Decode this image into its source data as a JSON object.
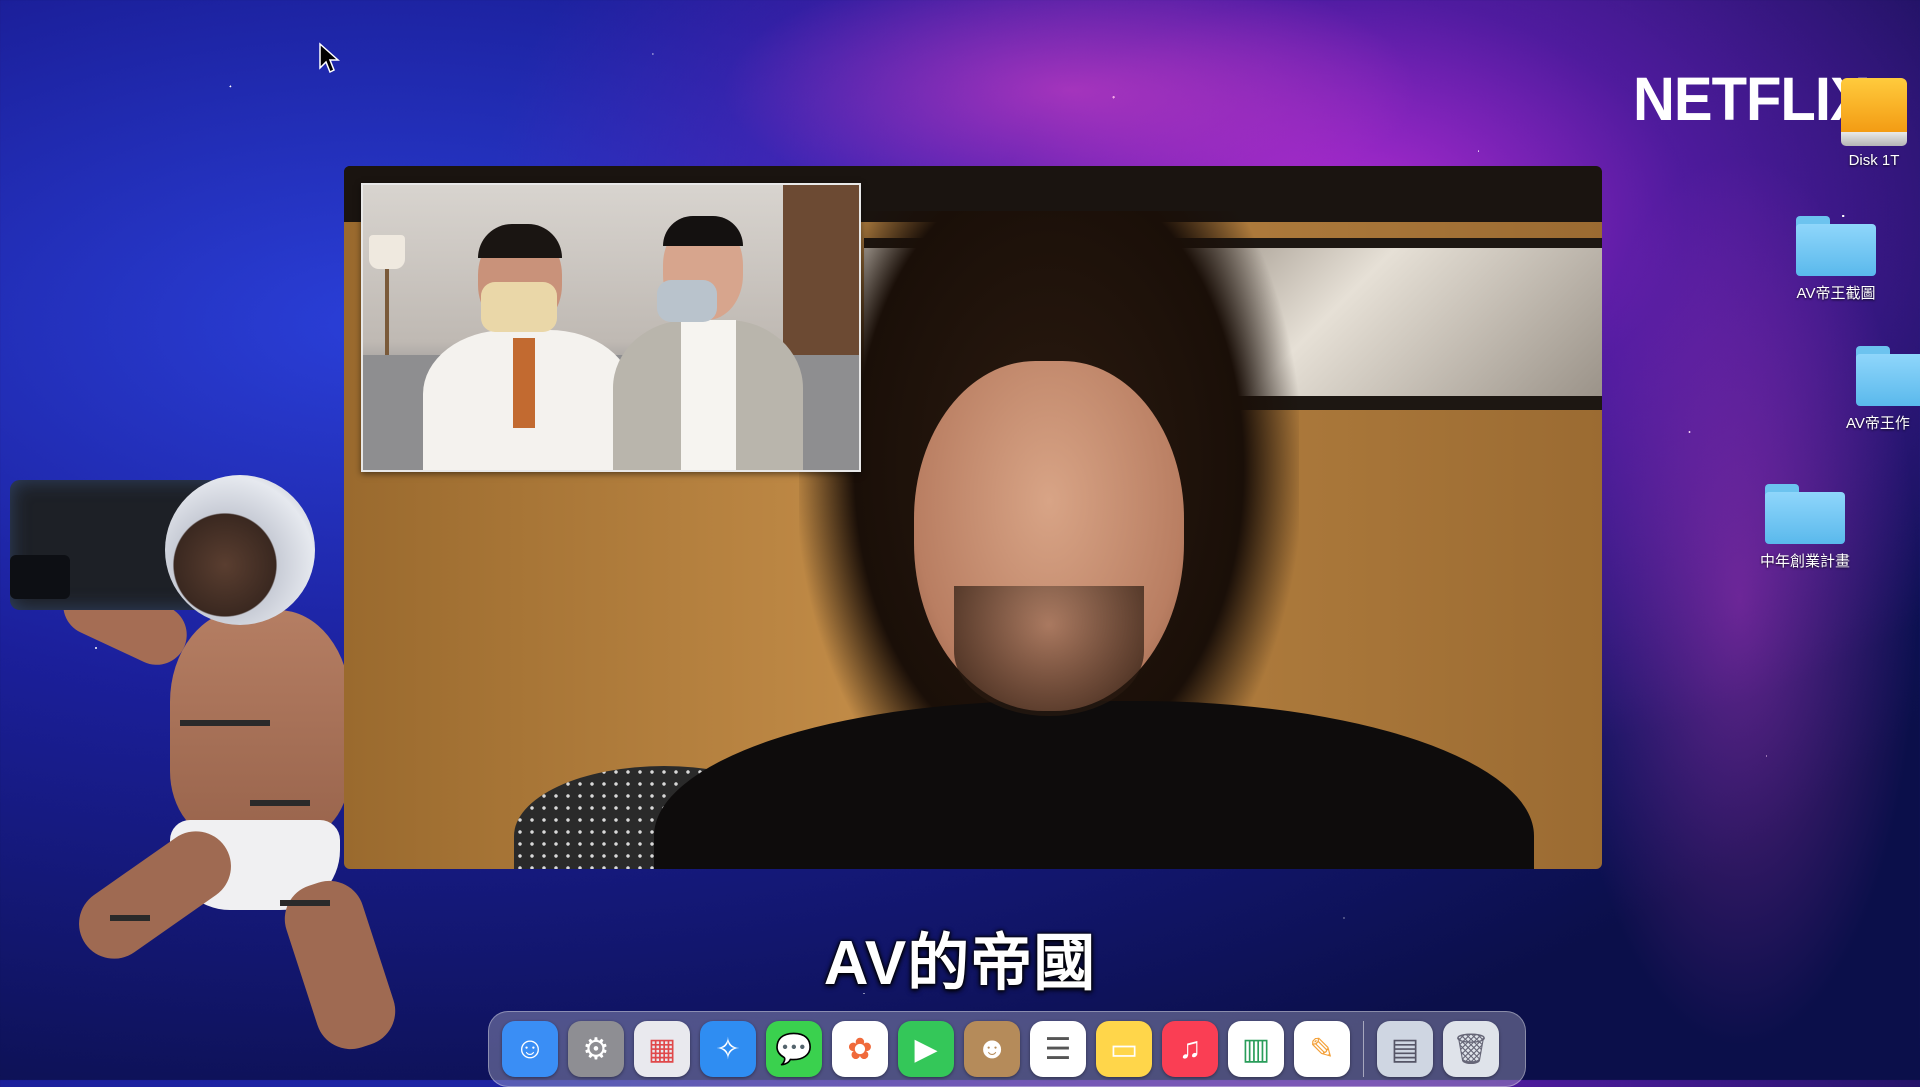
{
  "brand": {
    "logo_text": "NETFLIX"
  },
  "subtitle": {
    "text": "AV的帝國"
  },
  "desktop_icons": [
    {
      "label": "Disk 1T",
      "type": "drive"
    },
    {
      "label": "AV帝王截圖",
      "type": "folder"
    },
    {
      "label": "AV帝王作",
      "type": "folder"
    },
    {
      "label": "中年創業計畫",
      "type": "folder"
    }
  ],
  "dock": {
    "apps": [
      {
        "name": "finder-icon",
        "glyph": "☺",
        "color": "#3a8ef5"
      },
      {
        "name": "system-preferences-icon",
        "glyph": "⚙",
        "color": "#8e8e93"
      },
      {
        "name": "launchpad-icon",
        "glyph": "▦",
        "color": "#e9e9ee"
      },
      {
        "name": "safari-icon",
        "glyph": "✧",
        "color": "#2f8df2"
      },
      {
        "name": "messages-icon",
        "glyph": "💬",
        "color": "#3ad14e"
      },
      {
        "name": "photos-icon",
        "glyph": "✿",
        "color": "#ffffff"
      },
      {
        "name": "facetime-icon",
        "glyph": "▶",
        "color": "#34c759"
      },
      {
        "name": "contacts-icon",
        "glyph": "☻",
        "color": "#b58b5a"
      },
      {
        "name": "reminders-icon",
        "glyph": "☰",
        "color": "#ffffff"
      },
      {
        "name": "notes-icon",
        "glyph": "▭",
        "color": "#ffd64a"
      },
      {
        "name": "music-icon",
        "glyph": "♫",
        "color": "#fa3e54"
      },
      {
        "name": "numbers-icon",
        "glyph": "▥",
        "color": "#ffffff"
      },
      {
        "name": "pages-icon",
        "glyph": "✎",
        "color": "#f4a13a"
      }
    ],
    "right_items": [
      {
        "name": "downloads-icon",
        "glyph": "▤",
        "color": "#cfd6e2"
      },
      {
        "name": "trash-icon",
        "glyph": "🗑",
        "color": "#dfe3ea"
      }
    ]
  }
}
